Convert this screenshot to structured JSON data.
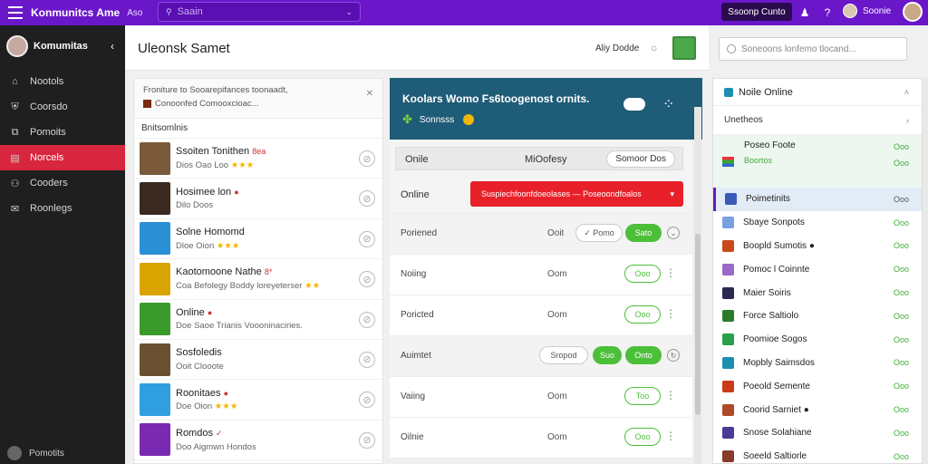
{
  "topbar": {
    "brand": "Konmunitcs Ame",
    "brand_sub": "Aso",
    "search_placeholder": "Saain",
    "action_button": "Ssoonp Cunto",
    "user_name": "Soonie"
  },
  "sidebar": {
    "user_name": "Komumitas",
    "items": [
      {
        "label": "Nootols",
        "icon": "map-icon"
      },
      {
        "label": "Coorsdo",
        "icon": "shield-icon"
      },
      {
        "label": "Pomoits",
        "icon": "tag-icon"
      },
      {
        "label": "Norcels",
        "icon": "card-icon",
        "active": true
      },
      {
        "label": "Cooders",
        "icon": "people-icon"
      },
      {
        "label": "Roonlegs",
        "icon": "mail-icon"
      }
    ],
    "footer": "Pomotits"
  },
  "header": {
    "title": "Uleonsk Samet",
    "account_label": "Aliy Dodde"
  },
  "friends": {
    "notice_line1": "Froniture to Sooarepifances toonaadt,",
    "notice_line2": "Conoonfed Comooxcioac...",
    "section_title": "Bnitsomlnis",
    "list": [
      {
        "name": "Ssoiten Tonithen",
        "badge": "8ea",
        "sub": "Dios Oao Loo",
        "stars": "★★★",
        "avatar": "#7a5a3a"
      },
      {
        "name": "Hosimee lon",
        "badge": "●",
        "sub": "Dilo Doos",
        "stars": "",
        "avatar": "#3a2a20"
      },
      {
        "name": "Solne Homomd",
        "badge": "",
        "sub": "Dloe Oion",
        "stars": "★★★",
        "avatar": "#2b8fd6"
      },
      {
        "name": "Kaotomoone Nathe",
        "badge": "8*",
        "sub": "Coa Befolegy Boddy loreyeterser",
        "stars": "★★",
        "avatar": "#d9a400"
      },
      {
        "name": "Online",
        "badge": "●",
        "sub": "Doe Saoe Trianis Voooninaciries.",
        "stars": "",
        "avatar": "#3a9a2a"
      },
      {
        "name": "Sosfoledis",
        "badge": "",
        "sub": "Ooit Clooote",
        "stars": "",
        "avatar": "#6a5030"
      },
      {
        "name": "Roonitaes",
        "badge": "●",
        "sub": "Doe Oion",
        "stars": "★★★",
        "avatar": "#2f9fe0"
      },
      {
        "name": "Romdos",
        "badge": "✓",
        "sub": "Doo Aigmwn Hondos",
        "stars": "",
        "avatar": "#7a2ab0"
      }
    ]
  },
  "center": {
    "banner_title": "Koolars Womo Fs6toogenost ornits.",
    "banner_sub": "Sonnsss",
    "status_row": {
      "left": "Onile",
      "middle": "MiOofesy",
      "right": "Somoor Dos"
    },
    "online_label": "Online",
    "alert_text": "Suspiechfoonfdoeolases — Poseoondfoalos",
    "requests": [
      {
        "label": "Poriened",
        "mid": "Ooit",
        "buttons": [
          "✓ Pomo",
          "Sato"
        ],
        "type": "accept"
      },
      {
        "label": "Noiing",
        "mid": "Oom",
        "buttons": [
          "Ooo"
        ],
        "type": "pending"
      },
      {
        "label": "Poricted",
        "mid": "Oom",
        "buttons": [
          "Ooo"
        ],
        "type": "pending"
      },
      {
        "label": "Auimtet",
        "mid": "",
        "buttons": [
          "Sropod",
          "Suo",
          "Onto"
        ],
        "type": "choose"
      },
      {
        "label": "Vaiing",
        "mid": "Oom",
        "buttons": [
          "Too"
        ],
        "type": "pending"
      },
      {
        "label": "Oilnie",
        "mid": "Oom",
        "buttons": [
          "Ooo"
        ],
        "type": "pending"
      }
    ]
  },
  "right": {
    "search_placeholder": "Soneoons lonfemo tlocand...",
    "panel_title": "Noile Online",
    "sub_title": "Unetheos",
    "top_item": {
      "name": "Poseo Foote",
      "status": "Boortos",
      "value1": "Ooo",
      "value2": "Ooo"
    },
    "items": [
      {
        "name": "Poimetinits",
        "value": "Ooo",
        "icon": "#3a5ab8",
        "hl": true
      },
      {
        "name": "Sbaye Sonpots",
        "value": "Ooo",
        "icon": "#7aa0e0"
      },
      {
        "name": "Boopld Sumotis ●",
        "value": "Ooo",
        "icon": "#c84a1a",
        "green": true
      },
      {
        "name": "Pomoc l Coinnte",
        "value": "Ooo",
        "icon": "#9a6ac8"
      },
      {
        "name": "Maier Soiris",
        "value": "Ooo",
        "icon": "#2a2a50"
      },
      {
        "name": "Force Saltiolo",
        "value": "Ooo",
        "icon": "#2a7a2a"
      },
      {
        "name": "Poomioe Sogos",
        "value": "Ooo",
        "icon": "#2aa04a",
        "green": true
      },
      {
        "name": "Mopbly Saimsdos",
        "value": "Ooo",
        "icon": "#1a8fb0"
      },
      {
        "name": "Poeold Semente",
        "value": "Ooo",
        "icon": "#c83a1a"
      },
      {
        "name": "Coorid Sarniet ●",
        "value": "Ooo",
        "icon": "#b04a2a"
      },
      {
        "name": "Snose Solahiane",
        "value": "Ooo",
        "icon": "#4a3a9a"
      },
      {
        "name": "Soeeld Saltiorle",
        "value": "Ooo",
        "icon": "#8a3a2a"
      }
    ]
  },
  "colors": {
    "brand": "#6a16c9",
    "accent_red": "#d7263d",
    "teal": "#1f5c78",
    "green": "#4cbf39"
  }
}
